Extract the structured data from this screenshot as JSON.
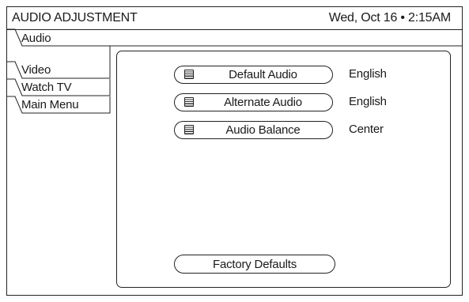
{
  "header": {
    "title": "AUDIO ADJUSTMENT",
    "datetime": "Wed, Oct 16 • 2:15AM"
  },
  "tabs": [
    {
      "label": "Audio",
      "active": true
    },
    {
      "label": "Video",
      "active": false
    },
    {
      "label": "Watch TV",
      "active": false
    },
    {
      "label": "Main Menu",
      "active": false
    }
  ],
  "menu": {
    "items": [
      {
        "label": "Default Audio",
        "value": "English",
        "icon": "list-icon"
      },
      {
        "label": "Alternate Audio",
        "value": "English",
        "icon": "list-icon"
      },
      {
        "label": "Audio Balance",
        "value": "Center",
        "icon": "list-icon"
      }
    ],
    "factory_defaults_label": "Factory Defaults"
  },
  "colors": {
    "background": "#ffffff",
    "line": "#222222",
    "text": "#1a1a1a"
  }
}
